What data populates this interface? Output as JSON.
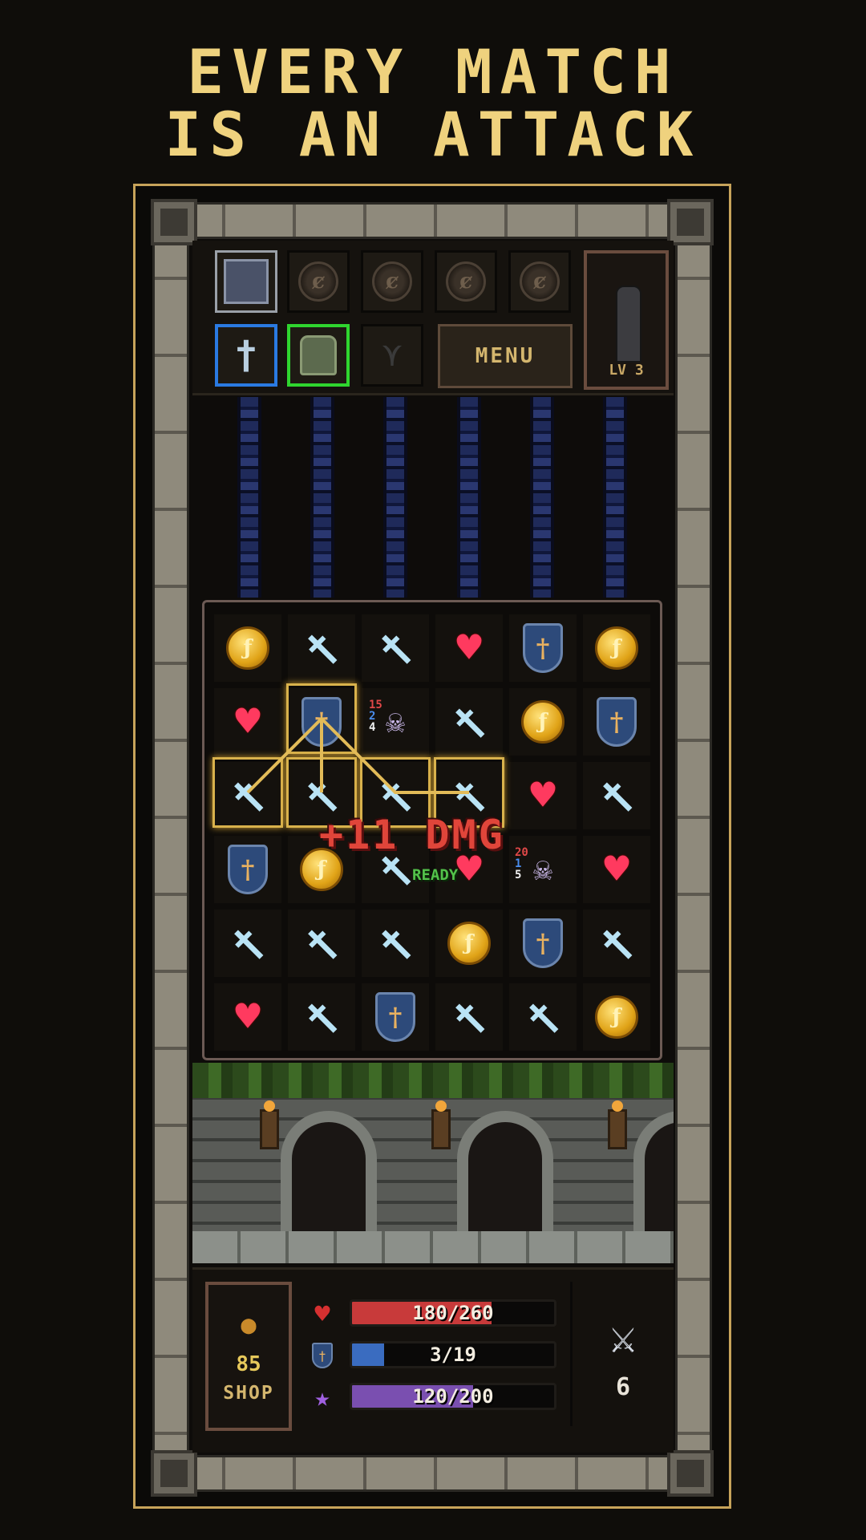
{
  "headline": {
    "line1": "EVERY MATCH",
    "line2": "IS AN ATTACK"
  },
  "top_panel": {
    "rune_slots": [
      "rune-icon",
      "rune-icon",
      "rune-icon",
      "rune-icon"
    ],
    "equipment": {
      "weapon": "sword-icon",
      "armor": "armor-icon",
      "amulet": "necklace-icon"
    },
    "menu_label": "MENU",
    "portrait_level": "LV 3"
  },
  "board": {
    "grid": [
      [
        "coin",
        "sword",
        "sword",
        "heart",
        "shield",
        "coin"
      ],
      [
        "heart",
        "shield",
        "skull",
        "sword",
        "coin",
        "shield"
      ],
      [
        "sword",
        "sword",
        "sword",
        "sword",
        "heart",
        "sword"
      ],
      [
        "shield",
        "coin",
        "sword",
        "heart",
        "skull",
        "heart"
      ],
      [
        "sword",
        "sword",
        "sword",
        "coin",
        "shield",
        "sword"
      ],
      [
        "heart",
        "sword",
        "shield",
        "sword",
        "sword",
        "coin"
      ]
    ],
    "enemy1": {
      "atk": "15",
      "def": "2",
      "hp": "4"
    },
    "enemy2": {
      "atk": "20",
      "def": "1",
      "hp": "5"
    },
    "damage_text": "+11 DMG",
    "ready_text": "READY"
  },
  "hud": {
    "gold": "85",
    "shop_label": "SHOP",
    "health": {
      "text": "180/260",
      "value": 180,
      "max": 260,
      "color": "#c83a3a"
    },
    "armor": {
      "text": "3/19",
      "value": 3,
      "max": 19,
      "color": "#3a6cc0"
    },
    "xp": {
      "text": "120/200",
      "value": 120,
      "max": 200,
      "color": "#7a4fb0"
    },
    "attack_count": "6"
  }
}
